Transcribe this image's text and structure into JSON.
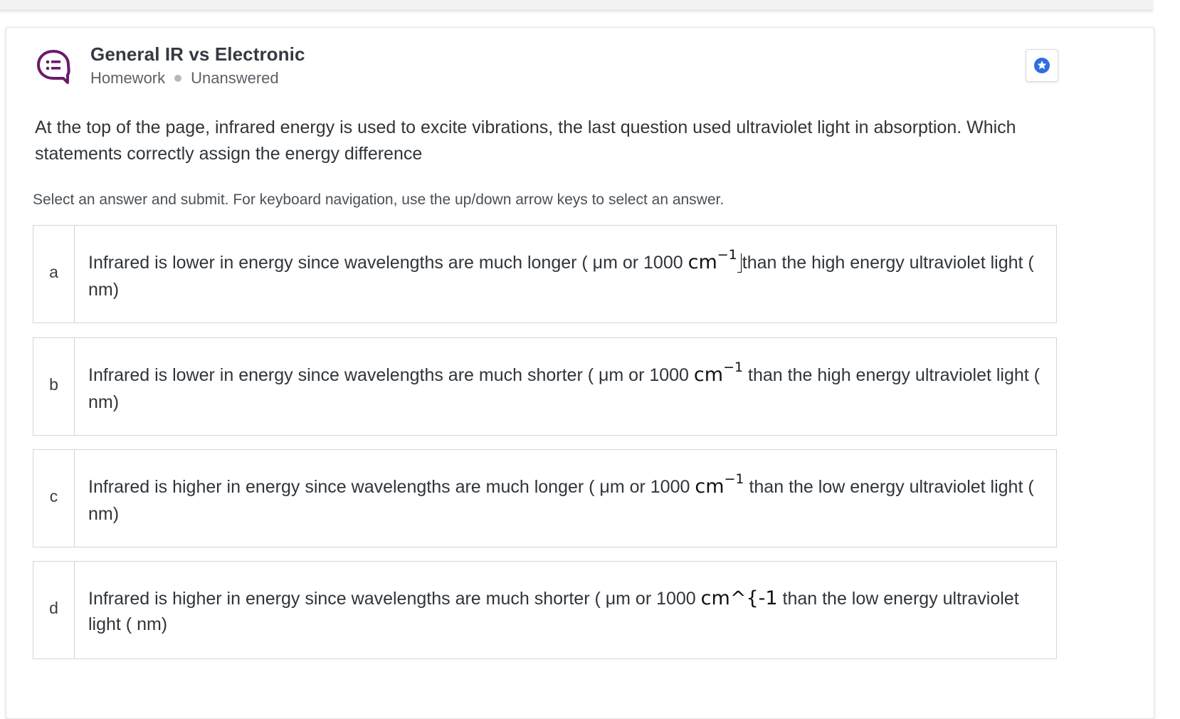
{
  "question": {
    "title": "General IR vs Electronic",
    "type": "Homework",
    "status": "Unanswered",
    "prompt": "At the top of the page, infrared energy is used to excite vibrations, the last question used ultraviolet light in absorption.  Which statements correctly assign the energy difference",
    "instructions": "Select an answer and submit. For keyboard navigation, use the up/down arrow keys to select an answer."
  },
  "icons": {
    "question_icon": "question-list-icon",
    "star_icon": "star-badge-icon"
  },
  "colors": {
    "question_icon": "#6b1a6b",
    "star_badge": "#2f6de1"
  },
  "choices": [
    {
      "letter": "a",
      "before": "Infrared is lower in energy since wavelengths are much longer  ( μm or 1000 ",
      "unit": "cm",
      "exponent": "−1",
      "after": "than the high energy ultraviolet light (",
      "line2": "nm)"
    },
    {
      "letter": "b",
      "before": "Infrared is lower in energy since wavelengths are much shorter  ( μm or 1000 ",
      "unit": "cm",
      "exponent": "−1",
      "after": " than the high energy ultraviolet light (",
      "line2": "nm)"
    },
    {
      "letter": "c",
      "before": "Infrared is higher in energy since wavelengths are much longer  ( μm or 1000 ",
      "unit": "cm",
      "exponent": "−1",
      "after": " than the low energy ultraviolet light (",
      "line2": "nm)"
    },
    {
      "letter": "d",
      "before": "Infrared is higher in energy since wavelengths are much shorter ( μm or 1000 ",
      "unit": "cm^{-1",
      "exponent": "",
      "after": " than the low energy ultraviolet",
      "line2": "light ( nm)"
    }
  ]
}
